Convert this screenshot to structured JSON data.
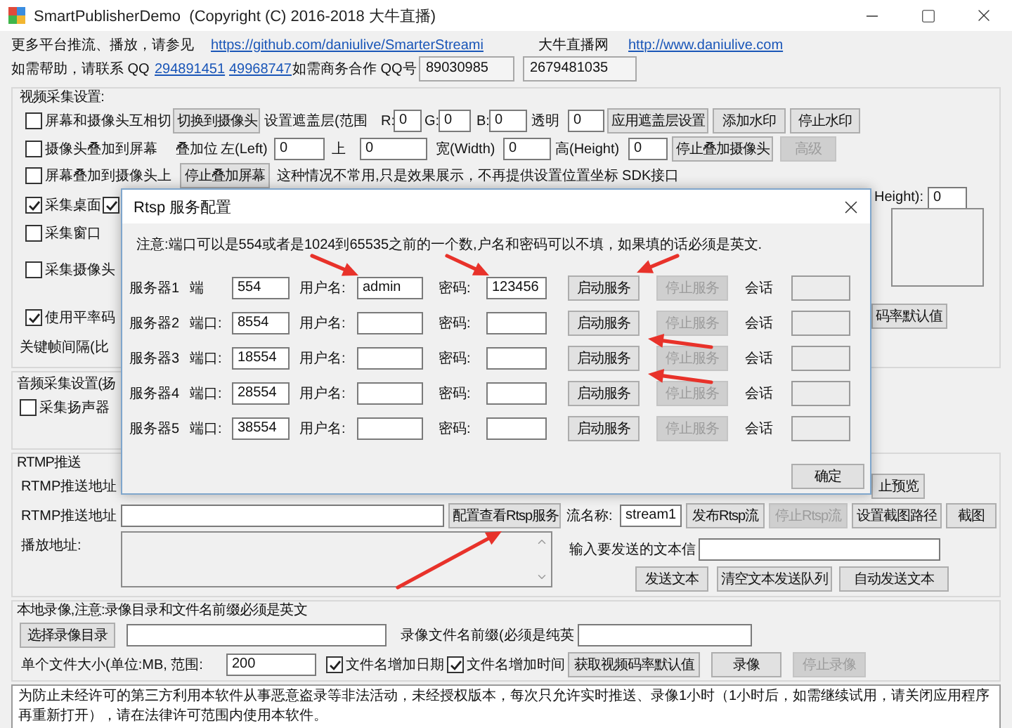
{
  "window": {
    "title": "SmartPublisherDemo  (Copyright (C) 2016-2018 大牛直播)"
  },
  "header_rows": [
    [
      {
        "kind": "label",
        "text": "更多平台推流、播放，请参见"
      },
      {
        "kind": "link",
        "text": "https://github.com/daniulive/SmarterStreami"
      },
      {
        "kind": "label",
        "text": "大牛直播网"
      },
      {
        "kind": "link",
        "text": "http://www.daniulive.com"
      }
    ],
    [
      {
        "kind": "label",
        "text": "如需帮助，请联系 QQ"
      },
      {
        "kind": "link",
        "text": "294891451"
      },
      {
        "kind": "link",
        "text": "49968747"
      },
      {
        "kind": "label",
        "text": "如需商务合作 QQ号"
      },
      {
        "kind": "display",
        "value": "89030985"
      },
      {
        "kind": "display",
        "value": "2679481035"
      }
    ]
  ],
  "video_group": {
    "title": "视频采集设置:",
    "rows": [
      {
        "controls": [
          {
            "kind": "checkbox",
            "label": "屏幕和摄像头互相切",
            "checked": false
          },
          {
            "kind": "button",
            "text": "切换到摄像头",
            "disabled": false
          },
          {
            "kind": "label",
            "text": "设置遮盖层(范围"
          },
          {
            "kind": "label",
            "text": "R:"
          },
          {
            "kind": "field",
            "value": "0"
          },
          {
            "kind": "label",
            "text": "G:"
          },
          {
            "kind": "field",
            "value": "0"
          },
          {
            "kind": "label",
            "text": "B:"
          },
          {
            "kind": "field",
            "value": "0"
          },
          {
            "kind": "label",
            "text": "透明"
          },
          {
            "kind": "field",
            "value": "0"
          },
          {
            "kind": "button",
            "text": "应用遮盖层设置",
            "disabled": false
          },
          {
            "kind": "button",
            "text": "添加水印",
            "disabled": false
          },
          {
            "kind": "button",
            "text": "停止水印",
            "disabled": false
          }
        ]
      },
      {
        "controls": [
          {
            "kind": "checkbox",
            "label": "摄像头叠加到屏幕",
            "checked": false
          },
          {
            "kind": "label",
            "text": "叠加位"
          },
          {
            "kind": "label",
            "text": "左(Left)"
          },
          {
            "kind": "field",
            "value": "0"
          },
          {
            "kind": "label",
            "text": "上"
          },
          {
            "kind": "field",
            "value": "0"
          },
          {
            "kind": "label",
            "text": "宽(Width)"
          },
          {
            "kind": "field",
            "value": "0"
          },
          {
            "kind": "label",
            "text": "高(Height)"
          },
          {
            "kind": "field",
            "value": "0"
          },
          {
            "kind": "button",
            "text": "停止叠加摄像头",
            "disabled": false
          },
          {
            "kind": "button",
            "text": "高级",
            "disabled": true
          }
        ]
      },
      {
        "controls": [
          {
            "kind": "checkbox",
            "label": "屏幕叠加到摄像头上",
            "checked": false
          },
          {
            "kind": "button",
            "text": "停止叠加屏幕",
            "disabled": false
          },
          {
            "kind": "label",
            "text": "这种情况不常用,只是效果展示，不再提供设置位置坐标 SDK接口"
          }
        ]
      }
    ],
    "left_rows": [
      [
        {
          "kind": "checkbox",
          "label": "采集桌面",
          "checked": true
        },
        {
          "kind": "checkbox",
          "checked": true
        }
      ],
      [
        {
          "kind": "checkbox",
          "label": "采集窗口",
          "checked": false
        }
      ],
      [
        {
          "kind": "checkbox",
          "label": "采集摄像头",
          "checked": false
        }
      ],
      [
        {
          "kind": "checkbox",
          "label": "使用平率码",
          "checked": true
        }
      ],
      [
        {
          "kind": "label",
          "text": "关键帧间隔(比"
        }
      ]
    ],
    "right_rows": [
      [
        {
          "kind": "label",
          "text": "Height):"
        },
        {
          "kind": "field",
          "value": "0"
        }
      ],
      [
        {
          "kind": "panel"
        }
      ],
      [
        {
          "kind": "button",
          "text": "码率默认值",
          "disabled": false
        }
      ]
    ]
  },
  "audio_group": {
    "title": "音频采集设置(扬",
    "rows": [
      [
        {
          "kind": "checkbox",
          "label": "采集扬声器",
          "checked": false
        }
      ]
    ]
  },
  "rtmp_group": {
    "title": "RTMP推送",
    "rows": [
      [
        {
          "kind": "label",
          "text": "RTMP推送地址"
        },
        {
          "kind": "button",
          "text": "止预览",
          "disabled": false
        }
      ],
      [
        {
          "kind": "label",
          "text": "RTMP推送地址"
        },
        {
          "kind": "field"
        },
        {
          "kind": "button",
          "text": "配置查看Rtsp服务",
          "disabled": false
        },
        {
          "kind": "label",
          "text": "流名称:"
        },
        {
          "kind": "field",
          "value": "stream1"
        },
        {
          "kind": "button",
          "text": "发布Rtsp流",
          "disabled": false
        },
        {
          "kind": "button",
          "text": "停止Rtsp流",
          "disabled": true
        },
        {
          "kind": "button",
          "text": "设置截图路径",
          "disabled": false
        },
        {
          "kind": "button",
          "text": "截图",
          "disabled": false
        }
      ]
    ],
    "playback_label": "播放地址:",
    "send_row": [
      {
        "kind": "label",
        "text": "输入要发送的文本信"
      },
      {
        "kind": "field"
      }
    ],
    "send_buttons": [
      {
        "kind": "button",
        "text": "发送文本",
        "disabled": false
      },
      {
        "kind": "button",
        "text": "清空文本发送队列",
        "disabled": false
      },
      {
        "kind": "button",
        "text": "自动发送文本",
        "disabled": false
      }
    ]
  },
  "record_group": {
    "title": "本地录像,注意:录像目录和文件名前缀必须是英文",
    "rows": [
      [
        {
          "kind": "button",
          "text": "选择录像目录",
          "disabled": false
        },
        {
          "kind": "field"
        },
        {
          "kind": "label",
          "text": "录像文件名前缀(必须是纯英"
        },
        {
          "kind": "field"
        }
      ],
      [
        {
          "kind": "label",
          "text": "单个文件大小(单位:MB, 范围:"
        },
        {
          "kind": "field",
          "value": "200"
        },
        {
          "kind": "checkbox",
          "label": "文件名增加日期",
          "checked": true
        },
        {
          "kind": "checkbox",
          "label": "文件名增加时间",
          "checked": true
        },
        {
          "kind": "button",
          "text": "获取视频码率默认值",
          "disabled": false
        },
        {
          "kind": "button",
          "text": "录像",
          "disabled": false
        },
        {
          "kind": "button",
          "text": "停止录像",
          "disabled": true
        }
      ]
    ]
  },
  "notice": "为防止未经许可的第三方利用本软件从事恶意盗录等非法活动，未经授权版本，每次只允许实时推送、录像1小时（1小时后，如需继续试用，请关闭应用程序再重新打开），请在法律许可范围内使用本软件。",
  "dialog": {
    "title": "Rtsp 服务配置",
    "note": "注意:端口可以是554或者是1024到65535之前的一个数,户名和密码可以不填，如果填的话必须是英文.",
    "servers": [
      [
        {
          "kind": "label",
          "text": "服务器1"
        },
        {
          "kind": "label",
          "text": "端"
        },
        {
          "kind": "field",
          "value": "554"
        },
        {
          "kind": "label",
          "text": "用户名:"
        },
        {
          "kind": "field",
          "value": "admin"
        },
        {
          "kind": "label",
          "text": "密码:"
        },
        {
          "kind": "field",
          "value": "123456"
        },
        {
          "kind": "button",
          "text": "启动服务",
          "disabled": false
        },
        {
          "kind": "button",
          "text": "停止服务",
          "disabled": true
        },
        {
          "kind": "label",
          "text": "会话"
        }
      ],
      [
        {
          "kind": "label",
          "text": "服务器2"
        },
        {
          "kind": "label",
          "text": "端口:"
        },
        {
          "kind": "field",
          "value": "8554"
        },
        {
          "kind": "label",
          "text": "用户名:"
        },
        {
          "kind": "field"
        },
        {
          "kind": "label",
          "text": "密码:"
        },
        {
          "kind": "field"
        },
        {
          "kind": "button",
          "text": "启动服务",
          "disabled": false
        },
        {
          "kind": "button",
          "text": "停止服务",
          "disabled": true
        },
        {
          "kind": "label",
          "text": "会话"
        }
      ],
      [
        {
          "kind": "label",
          "text": "服务器3"
        },
        {
          "kind": "label",
          "text": "端口:"
        },
        {
          "kind": "field",
          "value": "18554"
        },
        {
          "kind": "label",
          "text": "用户名:"
        },
        {
          "kind": "field"
        },
        {
          "kind": "label",
          "text": "密码:"
        },
        {
          "kind": "field"
        },
        {
          "kind": "button",
          "text": "启动服务",
          "disabled": false
        },
        {
          "kind": "button",
          "text": "停止服务",
          "disabled": true
        },
        {
          "kind": "label",
          "text": "会话"
        }
      ],
      [
        {
          "kind": "label",
          "text": "服务器4"
        },
        {
          "kind": "label",
          "text": "端口:"
        },
        {
          "kind": "field",
          "value": "28554"
        },
        {
          "kind": "label",
          "text": "用户名:"
        },
        {
          "kind": "field"
        },
        {
          "kind": "label",
          "text": "密码:"
        },
        {
          "kind": "field"
        },
        {
          "kind": "button",
          "text": "启动服务",
          "disabled": false
        },
        {
          "kind": "button",
          "text": "停止服务",
          "disabled": true
        },
        {
          "kind": "label",
          "text": "会话"
        }
      ],
      [
        {
          "kind": "label",
          "text": "服务器5"
        },
        {
          "kind": "label",
          "text": "端口:"
        },
        {
          "kind": "field",
          "value": "38554"
        },
        {
          "kind": "label",
          "text": "用户名:"
        },
        {
          "kind": "field"
        },
        {
          "kind": "label",
          "text": "密码:"
        },
        {
          "kind": "field"
        },
        {
          "kind": "button",
          "text": "启动服务",
          "disabled": false
        },
        {
          "kind": "button",
          "text": "停止服务",
          "disabled": true
        },
        {
          "kind": "label",
          "text": "会话"
        }
      ]
    ],
    "ok_button": "确定"
  }
}
